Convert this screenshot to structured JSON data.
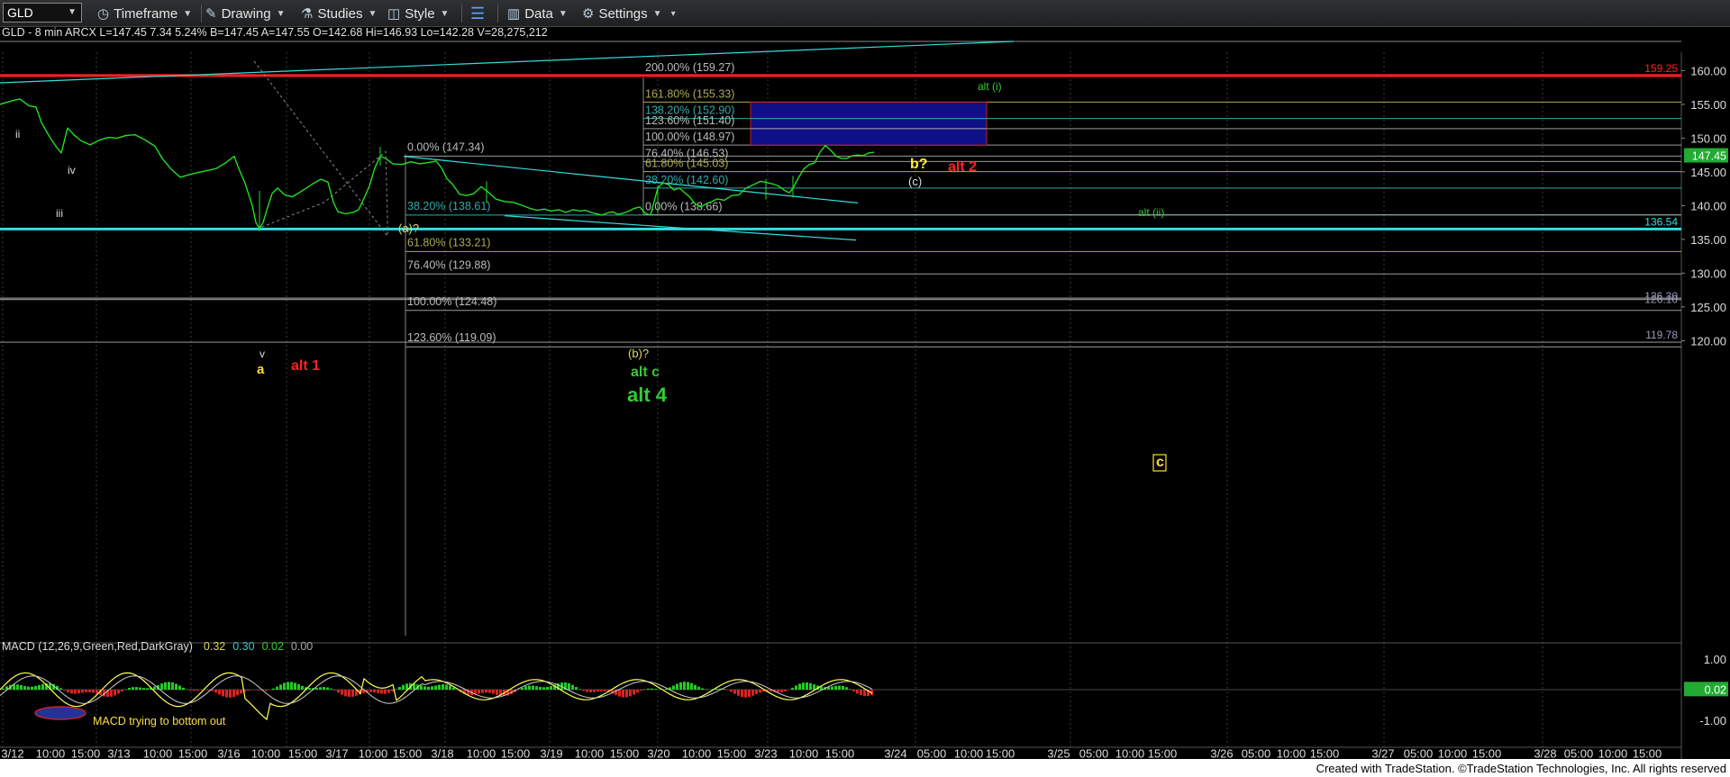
{
  "toolbar": {
    "symbol": "GLD",
    "items": [
      {
        "name": "timeframe",
        "label": "Timeframe",
        "icon": "clock-icon"
      },
      {
        "name": "drawing",
        "label": "Drawing",
        "icon": "pencil-icon"
      },
      {
        "name": "studies",
        "label": "Studies",
        "icon": "flask-icon"
      },
      {
        "name": "style",
        "label": "Style",
        "icon": "style-icon"
      },
      {
        "name": "layout",
        "label": "",
        "icon": "layout-icon"
      },
      {
        "name": "data",
        "label": "Data",
        "icon": "data-icon"
      },
      {
        "name": "settings",
        "label": "Settings",
        "icon": "gear-icon"
      }
    ]
  },
  "colors": {
    "background": "#000000",
    "price": "#22dd22",
    "cyan": "#33dddd",
    "red": "#ff2222",
    "fib": "#bbbbbb",
    "olive": "#aaaa55",
    "blue_box": "#10108f"
  },
  "header_text": "GLD - 8 min  ARCX  L=147.45  7.34  5.24%  B=147.45  A=147.55  O=142.68  Hi=146.93  Lo=142.28  V=28,275,212",
  "chart_data": {
    "type": "line",
    "symbol": "GLD",
    "interval": "8 min",
    "ylim": [
      116,
      163
    ],
    "y_ticks": [
      "160.00",
      "155.00",
      "150.00",
      "145.00",
      "140.00",
      "135.00",
      "130.00",
      "125.00",
      "120.00"
    ],
    "x_labels": [
      "3/12",
      "10:00",
      "15:00",
      "3/13",
      "10:00",
      "15:00",
      "3/16",
      "10:00",
      "15:00",
      "3/17",
      "10:00",
      "15:00",
      "3/18",
      "10:00",
      "15:00",
      "3/19",
      "10:00",
      "15:00",
      "3/20",
      "10:00",
      "15:00",
      "3/23",
      "10:00",
      "15:00",
      "3/24",
      "05:00",
      "10:00",
      "15:00",
      "3/25",
      "05:00",
      "10:00",
      "15:00",
      "3/26",
      "05:00",
      "10:00",
      "15:00",
      "3/27",
      "05:00",
      "10:00",
      "15:00",
      "3/28",
      "05:00",
      "10:00",
      "15:00"
    ],
    "series": [
      {
        "values": [
          [
            0,
            155.0
          ],
          [
            15,
            155.6
          ],
          [
            22,
            155.8
          ],
          [
            32,
            154.8
          ],
          [
            40,
            154.6
          ],
          [
            46,
            152.3
          ],
          [
            55,
            150.2
          ],
          [
            62,
            148.8
          ],
          [
            68,
            147.8
          ],
          [
            75,
            151.5
          ],
          [
            82,
            150.5
          ],
          [
            90,
            149.6
          ],
          [
            100,
            149.0
          ],
          [
            110,
            149.7
          ],
          [
            120,
            150.1
          ],
          [
            130,
            150.0
          ],
          [
            140,
            150.4
          ],
          [
            150,
            150.5
          ],
          [
            160,
            149.8
          ],
          [
            172,
            148.8
          ],
          [
            180,
            147.0
          ],
          [
            190,
            145.4
          ],
          [
            200,
            144.2
          ],
          [
            210,
            144.6
          ],
          [
            220,
            144.9
          ],
          [
            230,
            145.2
          ],
          [
            240,
            145.5
          ],
          [
            250,
            146.3
          ],
          [
            260,
            147.3
          ],
          [
            265,
            145.5
          ],
          [
            272,
            143.3
          ],
          [
            280,
            140.0
          ],
          [
            284,
            137.5
          ],
          [
            288,
            136.6
          ],
          [
            292,
            137.5
          ],
          [
            296,
            139.3
          ],
          [
            302,
            141.8
          ],
          [
            308,
            142.6
          ],
          [
            316,
            141.6
          ],
          [
            324,
            141.3
          ],
          [
            332,
            141.9
          ],
          [
            340,
            142.6
          ],
          [
            348,
            143.3
          ],
          [
            356,
            143.9
          ],
          [
            364,
            143.5
          ],
          [
            370,
            140.5
          ],
          [
            375,
            139.1
          ],
          [
            383,
            138.8
          ],
          [
            392,
            139.0
          ],
          [
            398,
            139.4
          ],
          [
            404,
            141.1
          ],
          [
            410,
            142.9
          ],
          [
            416,
            145.6
          ],
          [
            422,
            147.3
          ],
          [
            428,
            147.0
          ],
          [
            436,
            146.2
          ],
          [
            446,
            146.1
          ],
          [
            456,
            146.5
          ],
          [
            466,
            146.2
          ],
          [
            476,
            146.4
          ],
          [
            484,
            146.6
          ],
          [
            490,
            145.6
          ],
          [
            496,
            144.0
          ],
          [
            502,
            143.2
          ],
          [
            510,
            141.7
          ],
          [
            518,
            141.5
          ],
          [
            526,
            141.8
          ],
          [
            534,
            142.8
          ],
          [
            542,
            142.0
          ],
          [
            550,
            141.0
          ],
          [
            560,
            140.6
          ],
          [
            570,
            140.5
          ],
          [
            580,
            140.0
          ],
          [
            588,
            139.6
          ],
          [
            596,
            139.3
          ],
          [
            604,
            139.5
          ],
          [
            612,
            139.2
          ],
          [
            620,
            139.4
          ],
          [
            628,
            139.0
          ],
          [
            636,
            139.4
          ],
          [
            644,
            139.2
          ],
          [
            650,
            139.3
          ],
          [
            656,
            139.0
          ],
          [
            662,
            138.8
          ],
          [
            668,
            138.6
          ],
          [
            674,
            138.9
          ],
          [
            680,
            139.1
          ],
          [
            686,
            138.7
          ],
          [
            692,
            138.9
          ],
          [
            698,
            139.2
          ],
          [
            704,
            139.6
          ],
          [
            710,
            139.8
          ],
          [
            716,
            138.9
          ],
          [
            722,
            138.6
          ],
          [
            730,
            142.6
          ],
          [
            736,
            143.4
          ],
          [
            742,
            143.1
          ],
          [
            748,
            142.3
          ],
          [
            754,
            142.6
          ],
          [
            760,
            141.9
          ],
          [
            766,
            141.2
          ],
          [
            772,
            140.2
          ],
          [
            778,
            139.8
          ],
          [
            784,
            140.3
          ],
          [
            790,
            140.6
          ],
          [
            796,
            141.0
          ],
          [
            804,
            140.8
          ],
          [
            812,
            141.5
          ],
          [
            820,
            141.6
          ],
          [
            828,
            142.6
          ],
          [
            836,
            143.1
          ],
          [
            844,
            143.6
          ],
          [
            852,
            143.4
          ],
          [
            858,
            143.2
          ],
          [
            864,
            142.9
          ],
          [
            870,
            142.3
          ],
          [
            876,
            141.9
          ],
          [
            880,
            142.6
          ],
          [
            886,
            144.1
          ],
          [
            892,
            145.4
          ],
          [
            898,
            146.1
          ],
          [
            904,
            146.3
          ],
          [
            910,
            147.9
          ],
          [
            916,
            148.9
          ],
          [
            922,
            148.2
          ],
          [
            928,
            147.3
          ],
          [
            934,
            147.0
          ],
          [
            940,
            147.0
          ],
          [
            946,
            147.4
          ],
          [
            952,
            147.5
          ],
          [
            958,
            147.4
          ],
          [
            964,
            147.8
          ],
          [
            970,
            147.9
          ]
        ]
      }
    ],
    "horizontal_levels": [
      {
        "value": 159.27,
        "color": "red",
        "right_label": "159.25"
      },
      {
        "value": 136.54,
        "color": "cyan",
        "right_label": "136.54"
      },
      {
        "value": 126.3,
        "color": "gray",
        "right_label": "126.30"
      },
      {
        "value": 126.1,
        "color": "gray",
        "right_label": "126.10"
      },
      {
        "value": 119.78,
        "color": "gray",
        "right_label": "119.78"
      }
    ],
    "last_price": "147.45",
    "fib_left": {
      "levels": [
        {
          "pct": "0.00%",
          "value": "147.34",
          "price": 147.34
        },
        {
          "pct": "38.20%",
          "value": "138.61",
          "price": 138.61
        },
        {
          "pct": "61.80%",
          "value": "133.21",
          "price": 133.21
        },
        {
          "pct": "76.40%",
          "value": "129.88",
          "price": 129.88
        },
        {
          "pct": "100.00%",
          "value": "124.48",
          "price": 124.48
        },
        {
          "pct": "123.60%",
          "value": "119.09",
          "price": 119.09
        }
      ]
    },
    "fib_right_ext": {
      "levels": [
        {
          "pct": "200.00%",
          "value": "159.27",
          "price": 159.27
        },
        {
          "pct": "161.80%",
          "value": "155.33",
          "price": 155.33
        },
        {
          "pct": "138.20%",
          "value": "152.90",
          "price": 152.9
        },
        {
          "pct": "123.60%",
          "value": "151.40",
          "price": 151.4
        },
        {
          "pct": "100.00%",
          "value": "148.97",
          "price": 148.97
        }
      ]
    },
    "fib_right_ret": {
      "levels": [
        {
          "pct": "76.40%",
          "value": "146.53",
          "price": 146.53
        },
        {
          "pct": "61.80%",
          "value": "145.03",
          "price": 145.03
        },
        {
          "pct": "38.20%",
          "value": "142.60",
          "price": 142.6
        },
        {
          "pct": "0.00%",
          "value": "138.66",
          "price": 138.66
        }
      ]
    },
    "target_box": {
      "high": 155.33,
      "low": 148.97
    },
    "wave_labels": [
      {
        "text": "ii",
        "color": "#dddddd"
      },
      {
        "text": "iv",
        "color": "#dddddd"
      },
      {
        "text": "iii",
        "color": "#dddddd"
      },
      {
        "text": "v",
        "color": "#dddddd"
      },
      {
        "text": "a",
        "color": "#ffdd33"
      },
      {
        "text": "alt 1",
        "color": "#ff2222"
      },
      {
        "text": "(a)?",
        "color": "#dddd66"
      },
      {
        "text": "(b)?",
        "color": "#dddd66"
      },
      {
        "text": "alt c",
        "color": "#33cc33"
      },
      {
        "text": "alt 4",
        "color": "#33cc33"
      },
      {
        "text": "b?",
        "color": "#ffee33"
      },
      {
        "text": "(c)",
        "color": "#dddddd"
      },
      {
        "text": "alt 2",
        "color": "#ff2222"
      },
      {
        "text": "alt (i)",
        "color": "#33cc33"
      },
      {
        "text": "alt (ii)",
        "color": "#33cc33"
      },
      {
        "text": "c",
        "color": "#ffdd33"
      }
    ],
    "macd": {
      "label": "MACD (12,26,9,Green,Red,DarkGray)",
      "values": [
        "0.32",
        "0.30",
        "0.02",
        "0.00"
      ],
      "y_ticks": [
        "1.00",
        "-1.00"
      ],
      "last": "0.02",
      "annotation": "MACD trying to bottom out"
    }
  },
  "footer": "Created with TradeStation. ©TradeStation Technologies, Inc. All rights reserved"
}
